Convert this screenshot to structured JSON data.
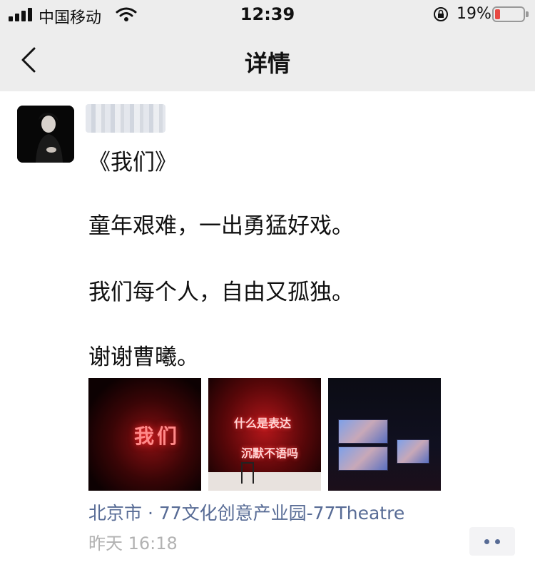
{
  "status_bar": {
    "carrier": "中国移动",
    "time": "12:39",
    "battery_percent": "19%",
    "battery_level": 0.19,
    "icons": [
      "signal-icon",
      "wifi-icon",
      "orientation-lock-icon",
      "battery-icon"
    ],
    "battery_color": "#e84a44"
  },
  "nav": {
    "title": "详情",
    "back_icon": "chevron-left-icon"
  },
  "post": {
    "lines": [
      "《我们》",
      "童年艰难，一出勇猛好戏。",
      "我们每个人，自由又孤独。",
      "谢谢曹曦。"
    ],
    "photos": [
      {
        "caption": "我们"
      },
      {
        "caption_line1": "什么是表达",
        "caption_line2": "沉默不语吗"
      },
      {
        "caption": ""
      }
    ],
    "location": "北京市 · 77文化创意产业园-77Theatre",
    "timestamp": "昨天 16:18",
    "more_icon": "more-dots-icon",
    "link_color": "#576b95"
  }
}
